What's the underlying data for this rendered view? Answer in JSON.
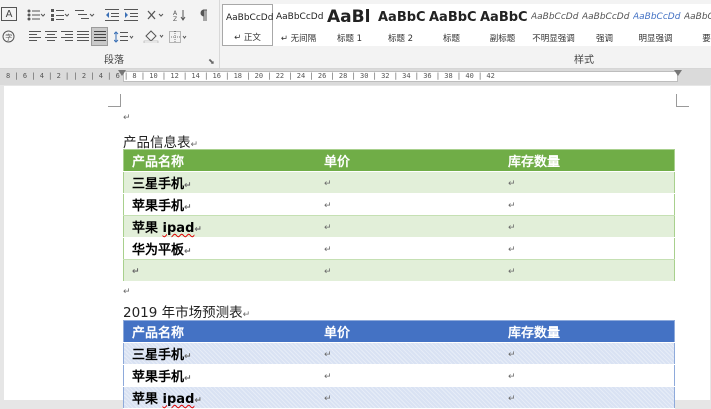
{
  "ribbon": {
    "paragraph_group_label": "段落",
    "styles_group_label": "样式",
    "launcher_icon": "dialog-launcher-icon",
    "styles": [
      {
        "sample": "AaBbCcDd",
        "name": "↵ 正文",
        "selected": true,
        "size": 9
      },
      {
        "sample": "AaBbCcDd",
        "name": "↵ 无间隔",
        "selected": false,
        "size": 9
      },
      {
        "sample": "AaBl",
        "name": "标题 1",
        "selected": false,
        "size": 17
      },
      {
        "sample": "AaBbC",
        "name": "标题 2",
        "selected": false,
        "size": 13
      },
      {
        "sample": "AaBbC",
        "name": "标题",
        "selected": false,
        "size": 13
      },
      {
        "sample": "AaBbC",
        "name": "副标题",
        "selected": false,
        "size": 13
      },
      {
        "sample": "AaBbCcDd",
        "name": "不明显强调",
        "selected": false,
        "size": 9
      },
      {
        "sample": "AaBbCcDd",
        "name": "强调",
        "selected": false,
        "size": 9
      },
      {
        "sample": "AaBbCcDd",
        "name": "明显强调",
        "selected": false,
        "size": 9
      },
      {
        "sample": "AaBbCcD",
        "name": "要",
        "selected": false,
        "size": 9
      }
    ]
  },
  "ruler": {
    "marks": "8 | 6 | 4 | 2 |   | 2 | 4 | 6 | 8 | 10 | 12 | 14 | 16 | 18 | 20 | 22 | 24 | 26 | 28 | 30 | 32 | 34 | 36 | 38 | 40 | 42"
  },
  "document": {
    "paragraph_mark": "↵",
    "table1": {
      "title": "产品信息表",
      "headers": [
        "产品名称",
        "单价",
        "库存数量"
      ],
      "rows": [
        [
          "三星手机",
          "",
          ""
        ],
        [
          "苹果手机",
          "",
          ""
        ],
        [
          "苹果 ipad",
          "",
          ""
        ],
        [
          "华为平板",
          "",
          ""
        ],
        [
          "",
          "",
          ""
        ]
      ]
    },
    "table2": {
      "title": "2019 年市场预测表",
      "headers": [
        "产品名称",
        "单价",
        "库存数量"
      ],
      "rows": [
        [
          "三星手机",
          "",
          ""
        ],
        [
          "苹果手机",
          "",
          ""
        ],
        [
          "苹果 ipad",
          "",
          ""
        ]
      ]
    }
  },
  "colors": {
    "green_header": "#70ad47",
    "green_band": "#e2efd9",
    "blue_header": "#4472c4",
    "blue_band": "#d9e2f3"
  }
}
